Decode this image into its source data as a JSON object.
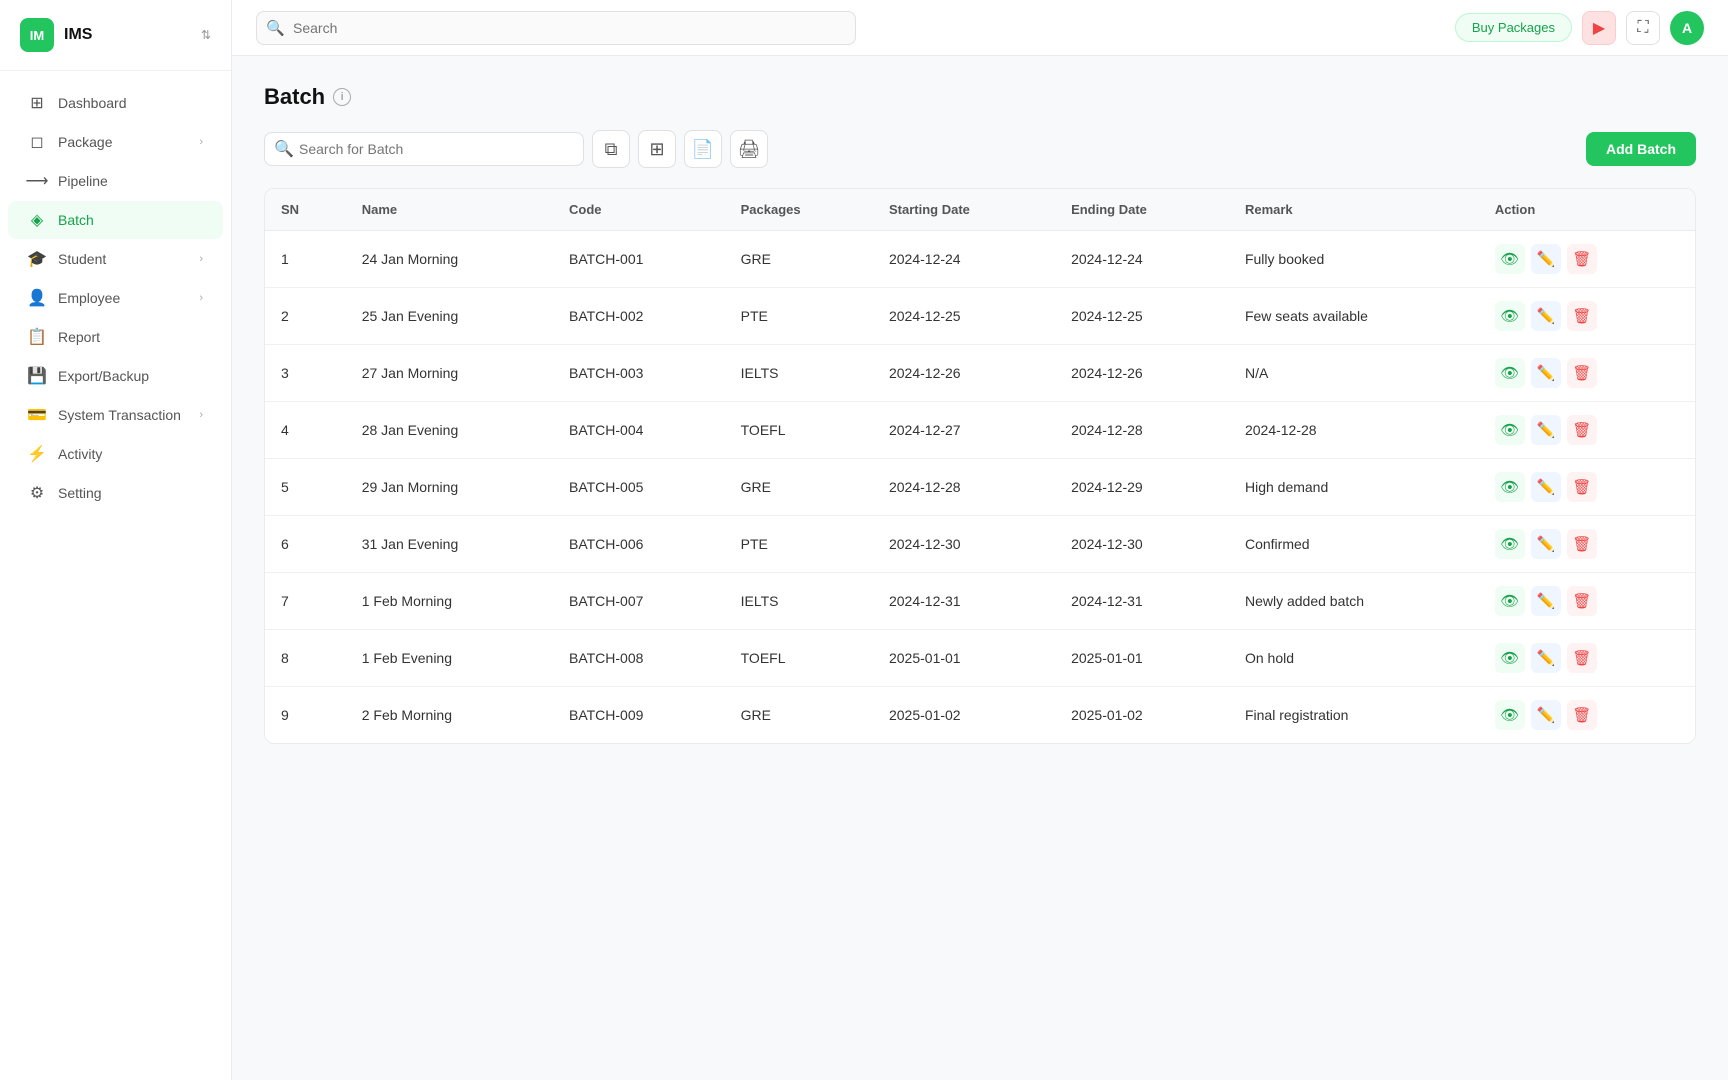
{
  "app": {
    "logo_initials": "IM",
    "logo_name": "IMS"
  },
  "sidebar": {
    "items": [
      {
        "id": "dashboard",
        "label": "Dashboard",
        "icon": "⊞"
      },
      {
        "id": "package",
        "label": "Package",
        "icon": "📦",
        "has_chevron": true
      },
      {
        "id": "pipeline",
        "label": "Pipeline",
        "icon": "⟾"
      },
      {
        "id": "batch",
        "label": "Batch",
        "icon": "◈",
        "active": true
      },
      {
        "id": "student",
        "label": "Student",
        "icon": "🎓",
        "has_chevron": true
      },
      {
        "id": "employee",
        "label": "Employee",
        "icon": "👤",
        "has_chevron": true
      },
      {
        "id": "report",
        "label": "Report",
        "icon": "📄"
      },
      {
        "id": "export-backup",
        "label": "Export/Backup",
        "icon": "💾"
      },
      {
        "id": "system-transaction",
        "label": "System Transaction",
        "icon": "💳",
        "has_chevron": true
      },
      {
        "id": "activity",
        "label": "Activity",
        "icon": "⚡"
      },
      {
        "id": "setting",
        "label": "Setting",
        "icon": "⚙"
      }
    ]
  },
  "topbar": {
    "search_placeholder": "Search",
    "buy_packages_label": "Buy Packages",
    "avatar_initial": "A"
  },
  "page": {
    "title": "Batch",
    "search_placeholder": "Search for Batch",
    "add_button_label": "Add Batch"
  },
  "table": {
    "columns": [
      "SN",
      "Name",
      "Code",
      "Packages",
      "Starting Date",
      "Ending Date",
      "Remark",
      "Action"
    ],
    "rows": [
      {
        "sn": 1,
        "name": "24 Jan Morning",
        "code": "BATCH-001",
        "packages": "GRE",
        "starting_date": "2024-12-24",
        "ending_date": "2024-12-24",
        "remark": "Fully booked"
      },
      {
        "sn": 2,
        "name": "25 Jan Evening",
        "code": "BATCH-002",
        "packages": "PTE",
        "starting_date": "2024-12-25",
        "ending_date": "2024-12-25",
        "remark": "Few seats available"
      },
      {
        "sn": 3,
        "name": "27 Jan Morning",
        "code": "BATCH-003",
        "packages": "IELTS",
        "starting_date": "2024-12-26",
        "ending_date": "2024-12-26",
        "remark": "N/A"
      },
      {
        "sn": 4,
        "name": "28 Jan Evening",
        "code": "BATCH-004",
        "packages": "TOEFL",
        "starting_date": "2024-12-27",
        "ending_date": "2024-12-28",
        "remark": "2024-12-28"
      },
      {
        "sn": 5,
        "name": "29 Jan Morning",
        "code": "BATCH-005",
        "packages": "GRE",
        "starting_date": "2024-12-28",
        "ending_date": "2024-12-29",
        "remark": "High demand"
      },
      {
        "sn": 6,
        "name": "31 Jan Evening",
        "code": "BATCH-006",
        "packages": "PTE",
        "starting_date": "2024-12-30",
        "ending_date": "2024-12-30",
        "remark": "Confirmed"
      },
      {
        "sn": 7,
        "name": "1 Feb Morning",
        "code": "BATCH-007",
        "packages": "IELTS",
        "starting_date": "2024-12-31",
        "ending_date": "2024-12-31",
        "remark": "Newly added batch"
      },
      {
        "sn": 8,
        "name": "1 Feb Evening",
        "code": "BATCH-008",
        "packages": "TOEFL",
        "starting_date": "2025-01-01",
        "ending_date": "2025-01-01",
        "remark": "On hold"
      },
      {
        "sn": 9,
        "name": "2 Feb Morning",
        "code": "BATCH-009",
        "packages": "GRE",
        "starting_date": "2025-01-02",
        "ending_date": "2025-01-02",
        "remark": "Final registration"
      }
    ]
  }
}
